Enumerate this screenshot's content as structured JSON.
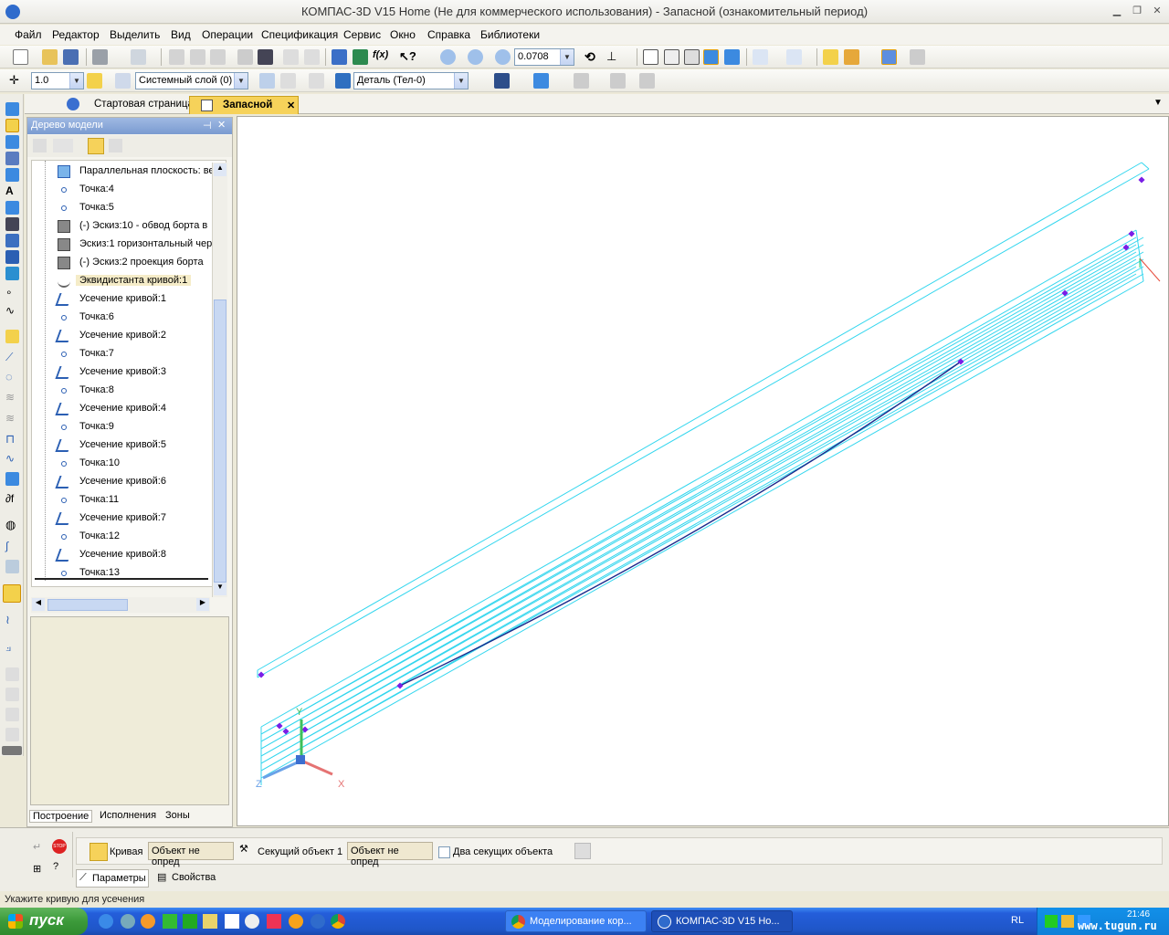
{
  "window": {
    "title": "КОМПАС-3D V15 Home (Не для коммерческого использования) - Запасной (ознакомительный период)"
  },
  "menu": [
    "Файл",
    "Редактор",
    "Выделить",
    "Вид",
    "Операции",
    "Спецификация",
    "Сервис",
    "Окно",
    "Справка",
    "Библиотеки"
  ],
  "toolbar": {
    "zoom_value": "0.0708",
    "step_value": "1.0",
    "layer_value": "Системный слой (0)",
    "detail_value": "Деталь (Тел-0)"
  },
  "tabs": [
    {
      "label": "Стартовая страница"
    },
    {
      "label": "Запасной"
    }
  ],
  "tree": {
    "title": "Дерево модели",
    "items": [
      {
        "label": "Параллельная плоскость: ве",
        "icon": "plane-icon"
      },
      {
        "label": "Точка:4",
        "icon": "point-icon"
      },
      {
        "label": "Точка:5",
        "icon": "point-icon"
      },
      {
        "label": "(-) Эскиз:10 - обвод борта в",
        "icon": "sketch-icon"
      },
      {
        "label": "Эскиз:1 горизонтальный чер",
        "icon": "sketch-icon"
      },
      {
        "label": "(-) Эскиз:2 проекция борта",
        "icon": "sketch-icon"
      },
      {
        "label": "Эквидистанта кривой:1",
        "icon": "offset-curve-icon",
        "selected": true
      },
      {
        "label": "Усечение кривой:1",
        "icon": "trim-curve-icon"
      },
      {
        "label": "Точка:6",
        "icon": "point-icon"
      },
      {
        "label": "Усечение кривой:2",
        "icon": "trim-curve-icon"
      },
      {
        "label": "Точка:7",
        "icon": "point-icon"
      },
      {
        "label": "Усечение кривой:3",
        "icon": "trim-curve-icon"
      },
      {
        "label": "Точка:8",
        "icon": "point-icon"
      },
      {
        "label": "Усечение кривой:4",
        "icon": "trim-curve-icon"
      },
      {
        "label": "Точка:9",
        "icon": "point-icon"
      },
      {
        "label": "Усечение кривой:5",
        "icon": "trim-curve-icon"
      },
      {
        "label": "Точка:10",
        "icon": "point-icon"
      },
      {
        "label": "Усечение кривой:6",
        "icon": "trim-curve-icon"
      },
      {
        "label": "Точка:11",
        "icon": "point-icon"
      },
      {
        "label": "Усечение кривой:7",
        "icon": "trim-curve-icon"
      },
      {
        "label": "Точка:12",
        "icon": "point-icon"
      },
      {
        "label": "Усечение кривой:8",
        "icon": "trim-curve-icon"
      },
      {
        "label": "Точка:13",
        "icon": "point-icon"
      }
    ],
    "footer_tabs": [
      "Построение",
      "Исполнения",
      "Зоны"
    ]
  },
  "viewport": {
    "axis_x": "X",
    "axis_y": "Y",
    "axis_z": "Z",
    "line_color": "#33d6ee",
    "curve_color": "#1a2a8c",
    "point_color": "#7a1ee6"
  },
  "properties_bar": {
    "curve_label": "Кривая",
    "curve_value": "Объект не опред",
    "cutting_label": "Секущий объект 1",
    "cutting_value": "Объект не опред",
    "two_cutting_label": "Два секущих объекта",
    "tab_params": "Параметры",
    "tab_props": "Свойства"
  },
  "status": {
    "hint": "Укажите кривую для усечения"
  },
  "taskbar": {
    "start": "пуск",
    "tasks": [
      "Моделирование кор...",
      "КОМПАС-3D V15 Ho..."
    ],
    "lang": "RL",
    "clock": "21:46",
    "watermark": "www.tugun.ru"
  }
}
